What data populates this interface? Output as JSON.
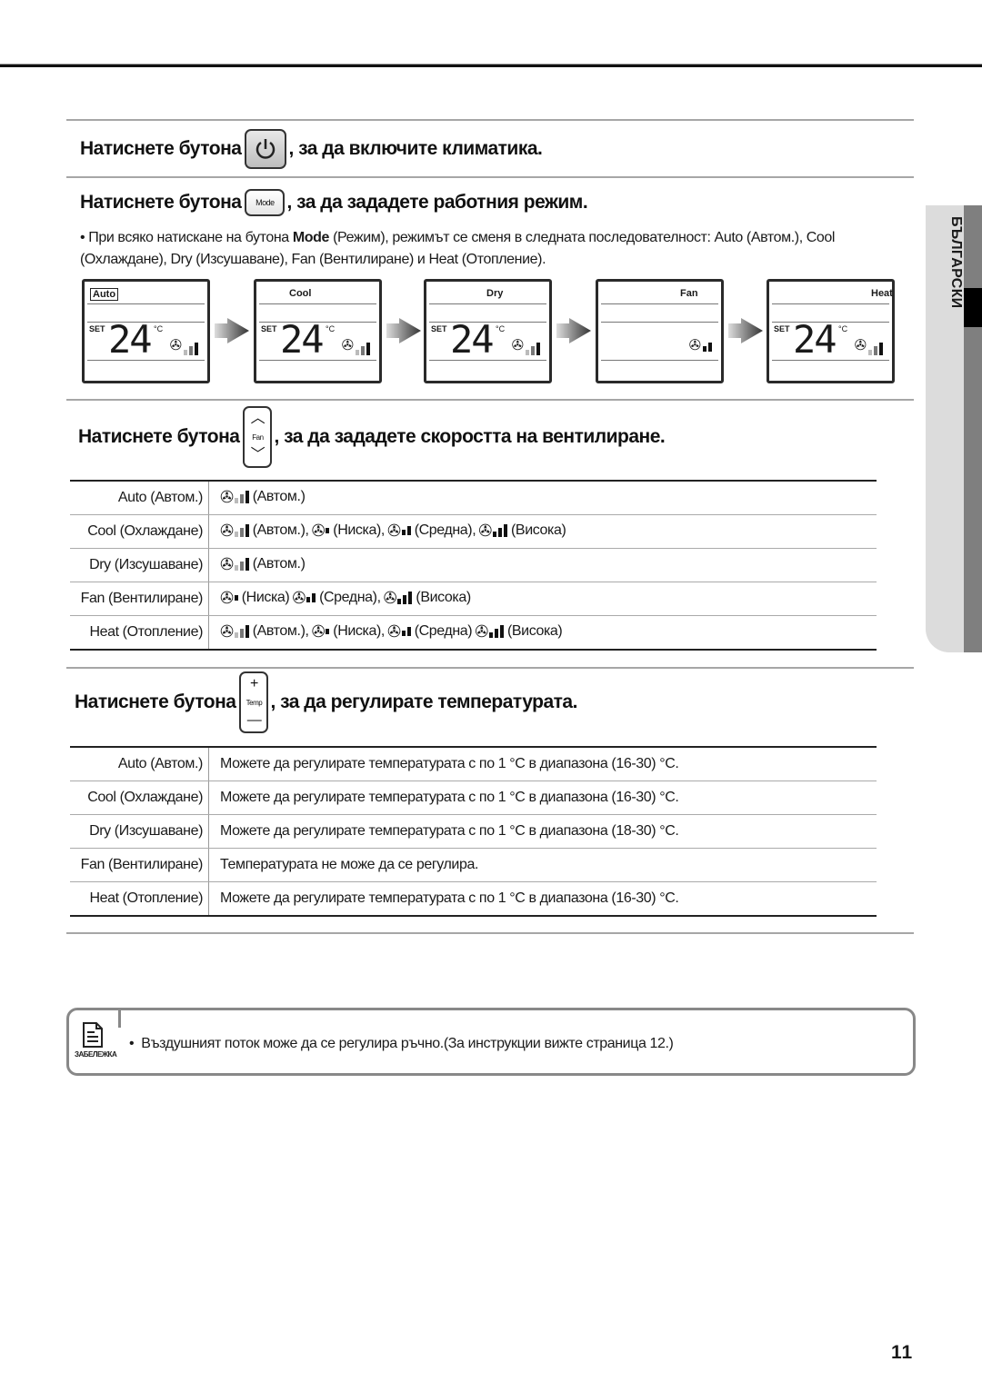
{
  "sidebar": {
    "language_label": "БЪЛГАРСКИ"
  },
  "section_power": {
    "prefix": "Натиснете бутона",
    "suffix": ", за да включите климатика.",
    "icon": "power-icon"
  },
  "section_mode": {
    "prefix": "Натиснете бутона",
    "button_label": "Mode",
    "suffix": ", за да зададете работния режим.",
    "bullet": "•",
    "text_before": "При всяко натискане на бутона ",
    "text_bold": "Mode",
    "text_after": " (Режим), режимът се сменя в следната последователност: Auto (Автом.), Cool (Охлаждане), Dry (Изсушаване), Fan (Вентилиране) и Heat (Отопление).",
    "displays": [
      {
        "mode": "Auto",
        "set": "SET",
        "temp": "24",
        "unit": "°C",
        "fan_bars": "auto"
      },
      {
        "mode": "Cool",
        "set": "SET",
        "temp": "24",
        "unit": "°C",
        "fan_bars": "auto"
      },
      {
        "mode": "Dry",
        "set": "SET",
        "temp": "24",
        "unit": "°C",
        "fan_bars": "auto"
      },
      {
        "mode": "Fan",
        "set": "",
        "temp": "",
        "unit": "",
        "fan_bars": "medium"
      },
      {
        "mode": "Heat",
        "set": "SET",
        "temp": "24",
        "unit": "°C",
        "fan_bars": "auto"
      }
    ]
  },
  "section_fan": {
    "prefix": "Натиснете бутона",
    "button_label": "Fan",
    "suffix": ", за да зададете скоростта на вентилиране.",
    "rows": [
      {
        "mode": "Auto (Автом.)",
        "options": [
          {
            "level": "auto",
            "label": "(Автом.)"
          }
        ]
      },
      {
        "mode": "Cool (Охлаждане)",
        "options": [
          {
            "level": "auto",
            "label": "(Автом.),"
          },
          {
            "level": "low",
            "label": "(Ниска),"
          },
          {
            "level": "medium",
            "label": "(Средна),"
          },
          {
            "level": "high",
            "label": "(Висока)"
          }
        ]
      },
      {
        "mode": "Dry (Изсушаване)",
        "options": [
          {
            "level": "auto",
            "label": "(Автом.)"
          }
        ]
      },
      {
        "mode": "Fan (Вентилиране)",
        "options": [
          {
            "level": "low",
            "label": "(Ниска)"
          },
          {
            "level": "medium",
            "label": "(Средна),"
          },
          {
            "level": "high",
            "label": "(Висока)"
          }
        ]
      },
      {
        "mode": "Heat (Отопление)",
        "options": [
          {
            "level": "auto",
            "label": "(Автом.),"
          },
          {
            "level": "low",
            "label": "(Ниска),"
          },
          {
            "level": "medium",
            "label": "(Средна)"
          },
          {
            "level": "high",
            "label": "(Висока)"
          }
        ]
      }
    ]
  },
  "section_temp": {
    "prefix": "Натиснете бутона",
    "button_label": "Temp",
    "plus": "+",
    "minus": "—",
    "suffix": ", за да регулирате температурата.",
    "rows": [
      {
        "mode": "Auto (Автом.)",
        "text": "Можете да регулирате температурата с по 1 °C в диапазона (16-30) °C."
      },
      {
        "mode": "Cool (Охлаждане)",
        "text": "Можете да регулирате температурата с по 1 °C в диапазона (16-30) °C."
      },
      {
        "mode": "Dry (Изсушаване)",
        "text": "Можете да регулирате температурата с по 1 °C в диапазона (18-30) °C."
      },
      {
        "mode": "Fan (Вентилиране)",
        "text": "Температурата не може да се регулира."
      },
      {
        "mode": "Heat (Отопление)",
        "text": "Можете да регулирате температурата с по 1 °C в диапазона (16-30) °C."
      }
    ]
  },
  "note": {
    "label": "ЗАБЕЛЕЖКА",
    "bullet": "•",
    "text": "Въздушният поток може да се регулира ръчно.(За инструкции вижте страница 12.)"
  },
  "page_number": "11"
}
